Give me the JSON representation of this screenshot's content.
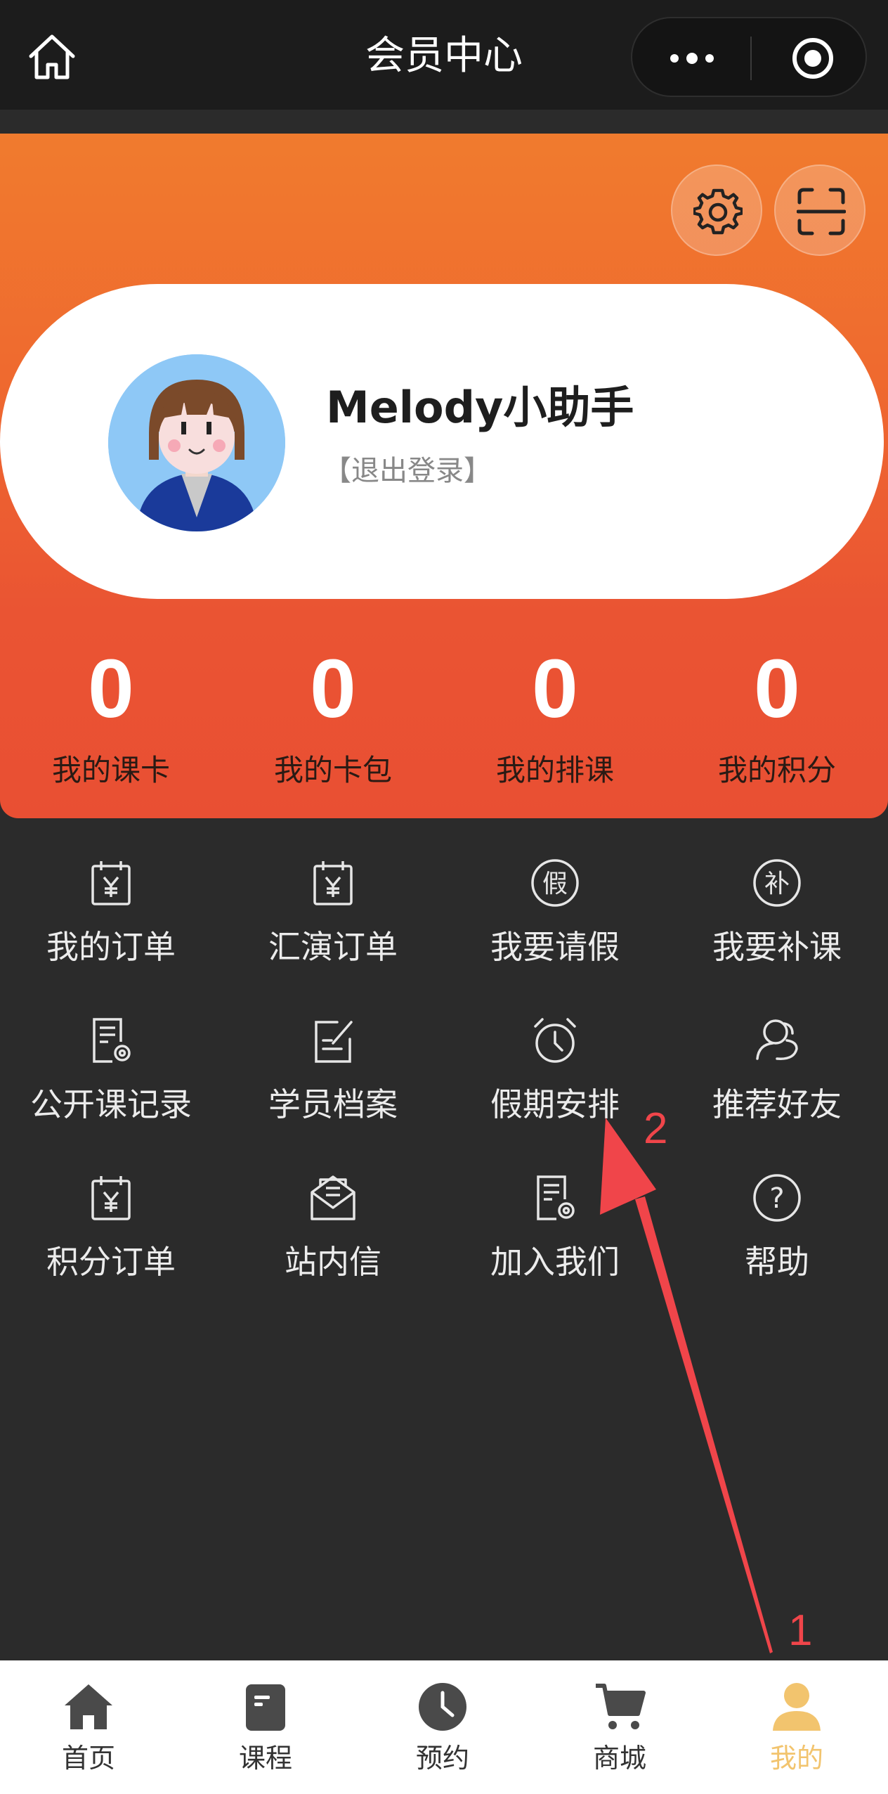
{
  "titlebar": {
    "title": "会员中心"
  },
  "profile": {
    "name": "Melody小助手",
    "logout": "【退出登录】"
  },
  "stats": [
    {
      "value": "0",
      "label": "我的课卡"
    },
    {
      "value": "0",
      "label": "我的卡包"
    },
    {
      "value": "0",
      "label": "我的排课"
    },
    {
      "value": "0",
      "label": "我的积分"
    }
  ],
  "menu": [
    {
      "label": "我的订单",
      "icon": "calendar-yen-icon"
    },
    {
      "label": "汇演订单",
      "icon": "calendar-yen-icon"
    },
    {
      "label": "我要请假",
      "icon": "leave-char-icon",
      "glyph": "假"
    },
    {
      "label": "我要补课",
      "icon": "makeup-char-icon",
      "glyph": "补"
    },
    {
      "label": "公开课记录",
      "icon": "document-gear-icon"
    },
    {
      "label": "学员档案",
      "icon": "edit-note-icon"
    },
    {
      "label": "假期安排",
      "icon": "alarm-clock-icon"
    },
    {
      "label": "推荐好友",
      "icon": "users-icon"
    },
    {
      "label": "积分订单",
      "icon": "calendar-yen-icon"
    },
    {
      "label": "站内信",
      "icon": "envelope-icon"
    },
    {
      "label": "加入我们",
      "icon": "document-gear-icon"
    },
    {
      "label": "帮助",
      "icon": "help-circle-icon",
      "glyph": "?"
    }
  ],
  "annotations": {
    "step1": "1",
    "step2": "2"
  },
  "tabbar": [
    {
      "label": "首页",
      "icon": "home-icon"
    },
    {
      "label": "课程",
      "icon": "course-icon"
    },
    {
      "label": "预约",
      "icon": "clock-icon"
    },
    {
      "label": "商城",
      "icon": "cart-icon"
    },
    {
      "label": "我的",
      "icon": "person-icon",
      "active": true
    }
  ],
  "colors": {
    "hero_top": "#f07b2e",
    "hero_bottom": "#e94f33",
    "active_tab": "#f2c46e",
    "annotation": "#f0454a"
  }
}
